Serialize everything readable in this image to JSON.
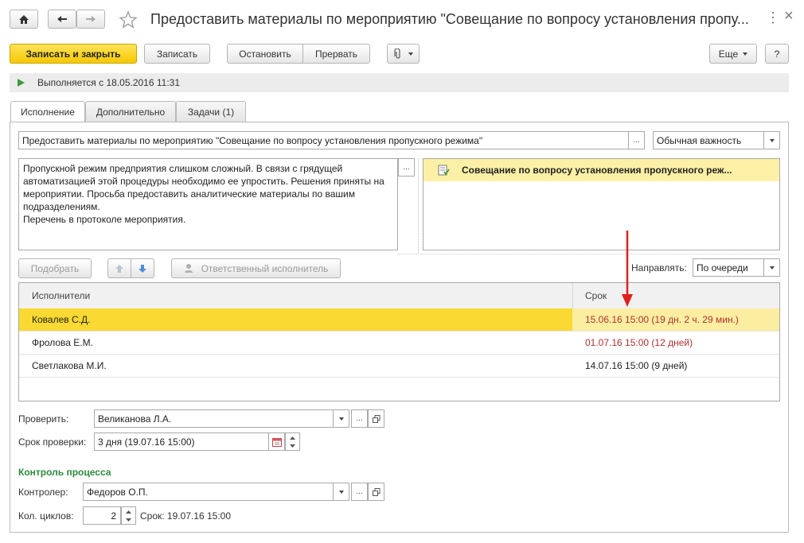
{
  "window": {
    "title": "Предоставить материалы по мероприятию \"Совещание по вопросу установления пропу...",
    "more_glyph": "⋮",
    "close_glyph": "×"
  },
  "toolbar": {
    "save_close_label": "Записать и закрыть",
    "save_label": "Записать",
    "stop_label": "Остановить",
    "interrupt_label": "Прервать",
    "more_label": "Еще",
    "help_label": "?"
  },
  "status": {
    "text": "Выполняется с 18.05.2016 11:31"
  },
  "tabs": [
    {
      "label": "Исполнение"
    },
    {
      "label": "Дополнительно"
    },
    {
      "label": "Задачи (1)"
    }
  ],
  "form": {
    "subject": "Предоставить материалы по мероприятию \"Совещание по вопросу установления пропускного режима\"",
    "importance": "Обычная важность",
    "description": "Пропускной режим предприятия слишком сложный. В связи с грядущей автоматизацией этой процедуры необходимо ее упростить. Решения приняты на мероприятии. Просьба предоставить аналитические материалы по вашим подразделениям.\nПеречень в протоколе мероприятия.",
    "attachment": "Совещание по вопросу установления пропускного реж...",
    "pick_label": "Подобрать",
    "responsible_label": "Ответственный исполнитель",
    "direct_label": "Направлять:",
    "direct_value": "По очереди",
    "ellipsis": "..."
  },
  "table": {
    "columns": [
      "Исполнители",
      "Срок"
    ],
    "rows": [
      {
        "name": "Ковалев С.Д.",
        "deadline": "15.06.16 15:00 (19 дн. 2 ч. 29 мин.)",
        "overdue": true,
        "selected": true
      },
      {
        "name": "Фролова Е.М.",
        "deadline": "01.07.16 15:00 (12 дней)",
        "overdue": true,
        "selected": false
      },
      {
        "name": "Светлакова М.И.",
        "deadline": "14.07.16 15:00 (9 дней)",
        "overdue": false,
        "selected": false
      }
    ]
  },
  "check": {
    "label": "Проверить:",
    "value": "Великанова Л.А.",
    "term_label": "Срок проверки:",
    "term_value": "3 дня (19.07.16 15:00)"
  },
  "process": {
    "heading": "Контроль процесса",
    "controller_label": "Контролер:",
    "controller_value": "Федоров О.П.",
    "cycles_label": "Кол. циклов:",
    "cycles_value": "2",
    "term_text": "Срок: 19.07.16 15:00"
  },
  "colors": {
    "accent_yellow": "#f9d932",
    "overdue_red": "#b03030",
    "green_heading": "#2c8a3d",
    "annotation_arrow": "#e02020"
  }
}
